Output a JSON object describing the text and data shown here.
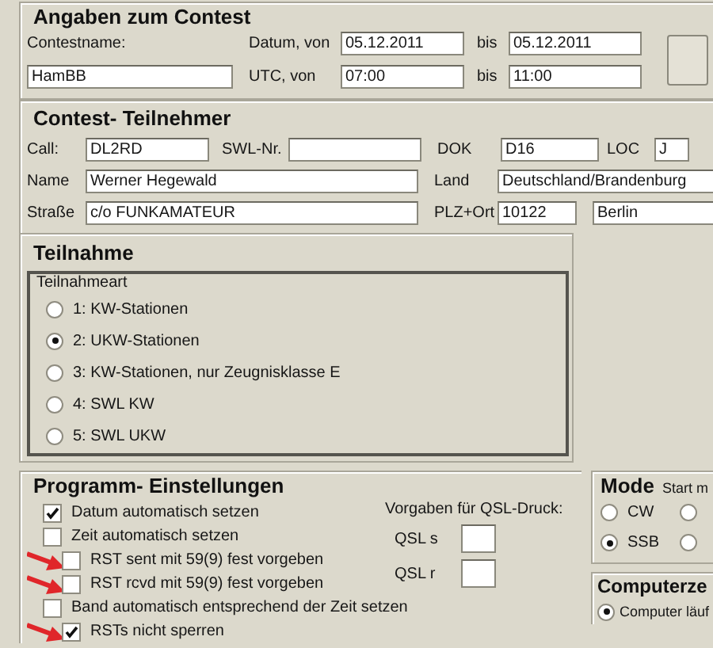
{
  "contest": {
    "title": "Angaben zum Contest",
    "name_label": "Contestname:",
    "name": "HamBB",
    "date_label": "Datum, von",
    "date_from": "05.12.2011",
    "date_to_label": "bis",
    "date_to": "05.12.2011",
    "time_label": "UTC, von",
    "time_from": "07:00",
    "time_to_label": "bis",
    "time_to": "11:00"
  },
  "participant": {
    "title": "Contest- Teilnehmer",
    "call_label": "Call:",
    "call": "DL2RD",
    "swl_label": "SWL-Nr.",
    "dok_label": "DOK",
    "dok": "D16",
    "loc_label": "LOC",
    "loc": "J",
    "name_label": "Name",
    "name": "Werner Hegewald",
    "land_label": "Land",
    "land": "Deutschland/Brandenburg",
    "street_label": "Straße",
    "street": "c/o FUNKAMATEUR",
    "city_label": "PLZ+Ort",
    "zip": "10122",
    "city": "Berlin"
  },
  "participation": {
    "title": "Teilnahme",
    "legend": "Teilnahmeart",
    "options": [
      {
        "label": "1: KW-Stationen",
        "selected": false
      },
      {
        "label": "2: UKW-Stationen",
        "selected": true
      },
      {
        "label": "3: KW-Stationen, nur Zeugnisklasse E",
        "selected": false
      },
      {
        "label": "4: SWL KW",
        "selected": false
      },
      {
        "label": "5: SWL UKW",
        "selected": false
      }
    ]
  },
  "settings": {
    "title": "Programm- Einstellungen",
    "options": [
      {
        "label": "Datum automatisch setzen",
        "checked": true,
        "marked": false
      },
      {
        "label": "Zeit automatisch setzen",
        "checked": false,
        "marked": false
      },
      {
        "label": "RST sent mit 59(9) fest vorgeben",
        "checked": false,
        "marked": true
      },
      {
        "label": "RST rcvd mit 59(9) fest vorgeben",
        "checked": false,
        "marked": true
      },
      {
        "label": "Band automatisch entsprechend der Zeit setzen",
        "checked": false,
        "marked": false
      },
      {
        "label": "RSTs nicht sperren",
        "checked": true,
        "marked": true
      }
    ],
    "qsl_title": "Vorgaben für QSL-Druck:",
    "qsl_fields": [
      {
        "label": "QSL s"
      },
      {
        "label": "QSL r"
      }
    ]
  },
  "mode": {
    "title": "Mode",
    "start_label": "Start m",
    "options": [
      {
        "label": "CW",
        "selected": false
      },
      {
        "label": "SSB",
        "selected": true
      }
    ],
    "start_options": [
      {
        "selected": false
      },
      {
        "selected": false
      }
    ]
  },
  "computer": {
    "title": "Computerze",
    "options": [
      {
        "label": "Computer läuf",
        "selected": true
      }
    ]
  }
}
